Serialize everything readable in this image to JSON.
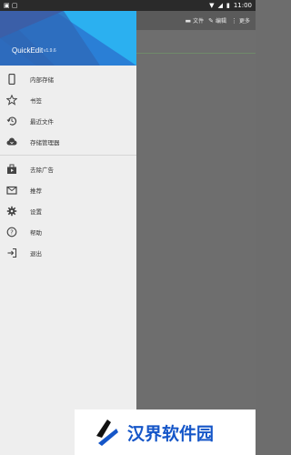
{
  "status_bar": {
    "time": "11:00"
  },
  "app_bar": {
    "items": [
      {
        "label": "文件",
        "icon": "folder-icon"
      },
      {
        "label": "编辑",
        "icon": "pencil-icon"
      },
      {
        "label": "更多",
        "icon": "more-vert-icon"
      }
    ]
  },
  "drawer": {
    "app_name": "QuickEdit",
    "version": "v1.9.6",
    "menu": [
      {
        "label": "内部存储",
        "icon": "phone-icon"
      },
      {
        "label": "书签",
        "icon": "star-outline-icon"
      },
      {
        "label": "最近文件",
        "icon": "history-icon"
      },
      {
        "label": "存储管理器",
        "icon": "cloud-download-icon"
      },
      {
        "label": "去除广告",
        "icon": "shop-icon"
      },
      {
        "label": "推荐",
        "icon": "mail-icon"
      },
      {
        "label": "设置",
        "icon": "gear-icon"
      },
      {
        "label": "帮助",
        "icon": "help-circle-icon"
      },
      {
        "label": "退出",
        "icon": "exit-icon"
      }
    ]
  },
  "watermark": {
    "text": "汉界软件园"
  },
  "colors": {
    "header_blue": "#2d6bbd",
    "header_light": "#2bb0f0",
    "watermark_blue": "#1556c8"
  }
}
